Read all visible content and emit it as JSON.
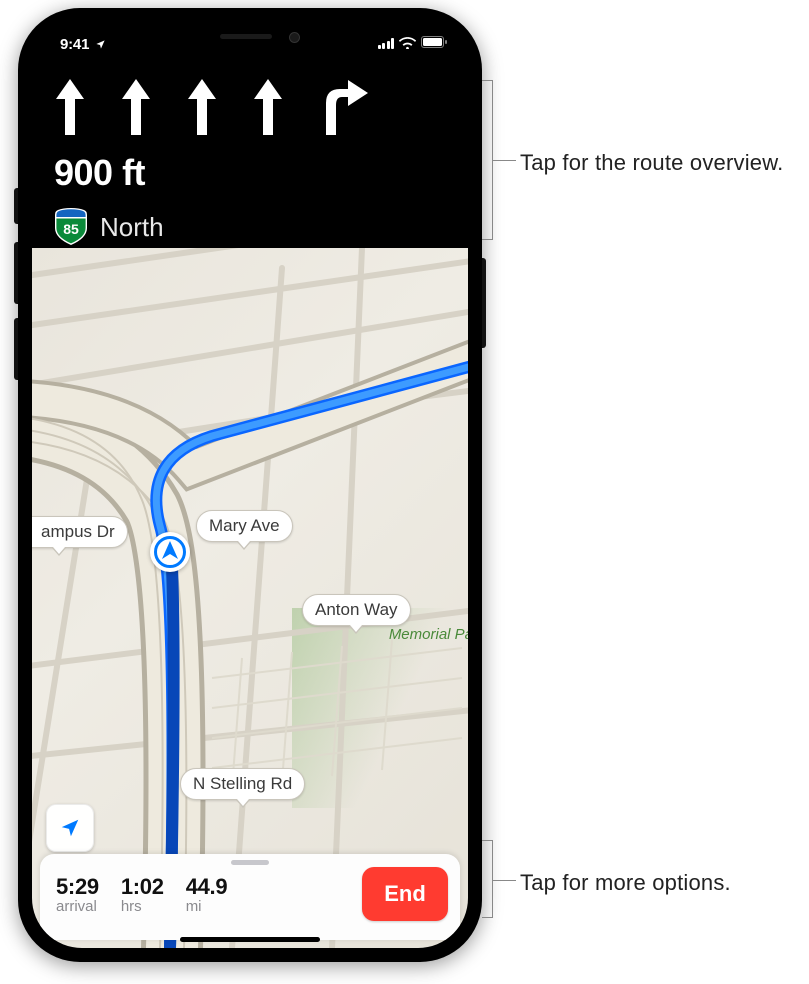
{
  "statusbar": {
    "time": "9:41"
  },
  "nav": {
    "distance": "900 ft",
    "route_shield_number": "85",
    "route_shield_region": "CALIFORNIA",
    "destination_direction": "North",
    "lane_count_straight": 4,
    "lane_turn_right": true
  },
  "map": {
    "labels": {
      "campus": "ampus Dr",
      "mary": "Mary Ave",
      "anton": "Anton Way",
      "stelling": "N Stelling Rd",
      "park": "Memorial Par"
    }
  },
  "tray": {
    "arrival_val": "5:29",
    "arrival_lab": "arrival",
    "duration_val": "1:02",
    "duration_lab": "hrs",
    "distance_val": "44.9",
    "distance_lab": "mi",
    "end_label": "End"
  },
  "callouts": {
    "top": "Tap for the route overview.",
    "bottom": "Tap for more options."
  }
}
